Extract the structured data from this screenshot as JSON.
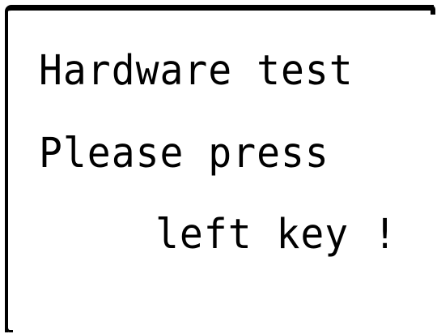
{
  "display": {
    "line1": "Hardware test",
    "line2": "Please press",
    "line3": "left key !"
  }
}
